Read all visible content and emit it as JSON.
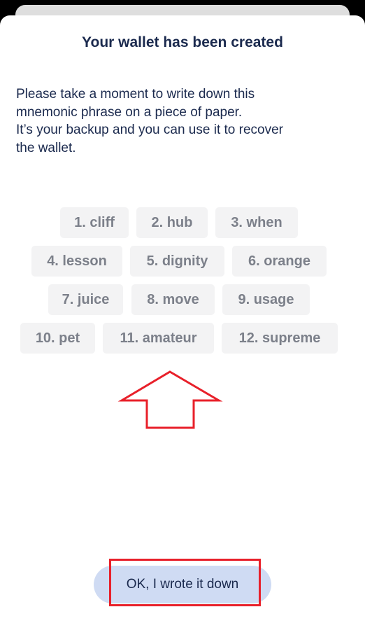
{
  "header": {
    "title": "Your wallet has been created"
  },
  "description": "Please take a moment to write down this\nmnemonic phrase on a piece of paper.\nIt’s your backup and you can use it to recover\nthe wallet.",
  "mnemonic": {
    "words": [
      "1. cliff",
      "2. hub",
      "3. when",
      "4. lesson",
      "5. dignity",
      "6. orange",
      "7. juice",
      "8. move",
      "9. usage",
      "10. pet",
      "11. amateur",
      "12. supreme"
    ]
  },
  "annotation": {
    "arrow_color": "#e8202a",
    "arrow_direction": "up"
  },
  "footer": {
    "confirm_label": "OK, I wrote it down"
  },
  "colors": {
    "text_primary": "#1b2a4e",
    "chip_bg": "#f3f3f4",
    "chip_text": "#7c808a",
    "button_bg": "#cfdbf3",
    "highlight": "#e8202a"
  }
}
